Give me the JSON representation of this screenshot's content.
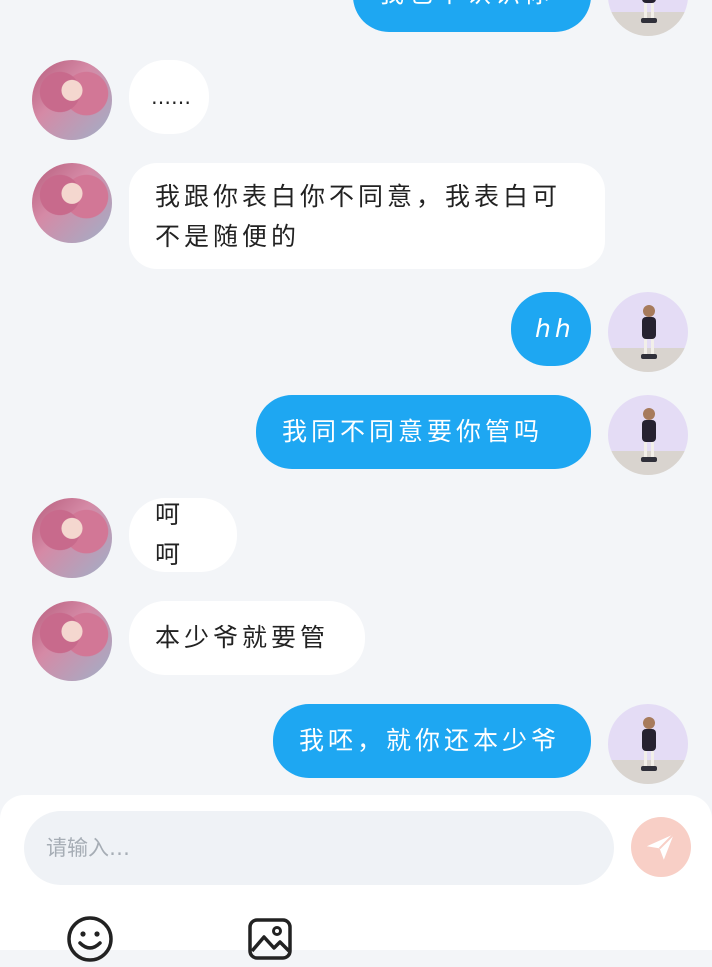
{
  "messages": [
    {
      "side": "out",
      "text": "我也不认识你",
      "avatar": "girl-doll-avatar"
    },
    {
      "side": "in",
      "text": "……",
      "avatar": "pink-hair-avatar"
    },
    {
      "side": "in",
      "lines": [
        "我跟你表白你不同意，我表白可",
        "不是随便的"
      ],
      "avatar": "pink-hair-avatar"
    },
    {
      "side": "out",
      "text": "hh",
      "avatar": "girl-doll-avatar"
    },
    {
      "side": "out",
      "text": "我同不同意要你管吗",
      "avatar": "girl-doll-avatar"
    },
    {
      "side": "in",
      "text": "呵呵",
      "avatar": "pink-hair-avatar"
    },
    {
      "side": "in",
      "text": "本少爷就要管",
      "avatar": "pink-hair-avatar"
    },
    {
      "side": "out",
      "text": "我呸，就你还本少爷",
      "avatar": "girl-doll-avatar"
    }
  ],
  "composer": {
    "placeholder": "请输入…",
    "send_icon": "paper-plane-icon",
    "send_color": "#f8cfc6",
    "tools": [
      "emoji-icon",
      "image-icon"
    ]
  },
  "colors": {
    "outgoing_bubble": "#1ea7f2",
    "incoming_bubble": "#ffffff",
    "background": "#f3f5f8"
  }
}
